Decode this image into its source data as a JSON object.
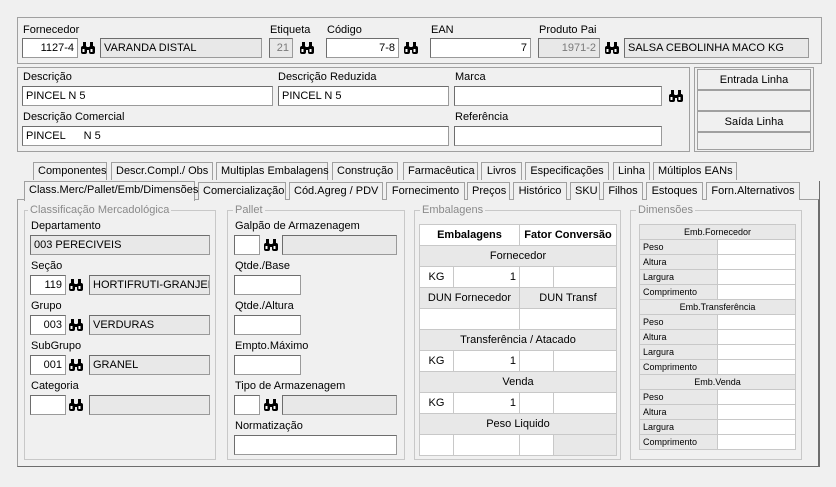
{
  "top": {
    "fornecedor_label": "Fornecedor",
    "fornecedor_code": "1127-4",
    "fornecedor_name": "VARANDA DISTAL",
    "etiqueta_label": "Etiqueta",
    "etiqueta_value": "21",
    "codigo_label": "Código",
    "codigo_value": "7-8",
    "ean_label": "EAN",
    "ean_value": "7",
    "produto_pai_label": "Produto Pai",
    "produto_pai_code": "1971-2",
    "produto_pai_name": "SALSA CEBOLINHA MACO KG"
  },
  "desc": {
    "descricao_label": "Descrição",
    "descricao_value": "PINCEL N 5",
    "reduzida_label": "Descrição Reduzida",
    "reduzida_value": "PINCEL N 5",
    "marca_label": "Marca",
    "marca_value": "",
    "comercial_label": "Descrição Comercial",
    "comercial_value": "PINCEL      N 5",
    "referencia_label": "Referência",
    "referencia_value": ""
  },
  "buttons": {
    "entrada": "Entrada Linha",
    "saida": "Saída Linha"
  },
  "tabs_row1": [
    "Componentes",
    "Descr.Compl./ Obs",
    "Multiplas Embalagens",
    "Construção",
    "Farmacêutica",
    "Livros",
    "Especificações",
    "Linha",
    "Múltiplos EANs"
  ],
  "tabs_row2": [
    "Class.Merc/Pallet/Emb/Dimensões",
    "Comercialização",
    "Cód.Agreg / PDV",
    "Fornecimento",
    "Preços",
    "Histórico",
    "SKU",
    "Filhos",
    "Estoques",
    "Forn.Alternativos"
  ],
  "classificacao": {
    "title": "Classificação Mercadológica",
    "departamento_label": "Departamento",
    "departamento_value": "003 PERECIVEIS",
    "secao_label": "Seção",
    "secao_code": "119",
    "secao_name": "HORTIFRUTI-GRANJEIRO",
    "grupo_label": "Grupo",
    "grupo_code": "003",
    "grupo_name": "VERDURAS",
    "subgrupo_label": "SubGrupo",
    "subgrupo_code": "001",
    "subgrupo_name": "GRANEL",
    "categoria_label": "Categoria",
    "categoria_code": "",
    "categoria_name": ""
  },
  "pallet": {
    "title": "Pallet",
    "galpao_label": "Galpão de Armazenagem",
    "qtde_base_label": "Qtde./Base",
    "qtde_altura_label": "Qtde./Altura",
    "empto_label": "Empto.Máximo",
    "tipo_label": "Tipo de Armazenagem",
    "normatizacao_label": "Normatização"
  },
  "embalagens": {
    "title": "Embalagens",
    "col1": "Embalagens",
    "col2": "Fator Conversão",
    "fornecedor": "Fornecedor",
    "kg1": "KG",
    "kg1_value": "1",
    "dun_fornecedor": "DUN Fornecedor",
    "dun_transf": "DUN Transf",
    "transferencia": "Transferência / Atacado",
    "kg2": "KG",
    "kg2_value": "1",
    "venda": "Venda",
    "kg3": "KG",
    "kg3_value": "1",
    "peso_liquido": "Peso Liquido"
  },
  "dimensoes": {
    "title": "Dimensões",
    "sections": [
      {
        "name": "Emb.Fornecedor",
        "rows": [
          "Peso",
          "Altura",
          "Largura",
          "Comprimento"
        ]
      },
      {
        "name": "Emb.Transferência",
        "rows": [
          "Peso",
          "Altura",
          "Largura",
          "Comprimento"
        ]
      },
      {
        "name": "Emb.Venda",
        "rows": [
          "Peso",
          "Altura",
          "Largura",
          "Comprimento"
        ]
      }
    ]
  }
}
